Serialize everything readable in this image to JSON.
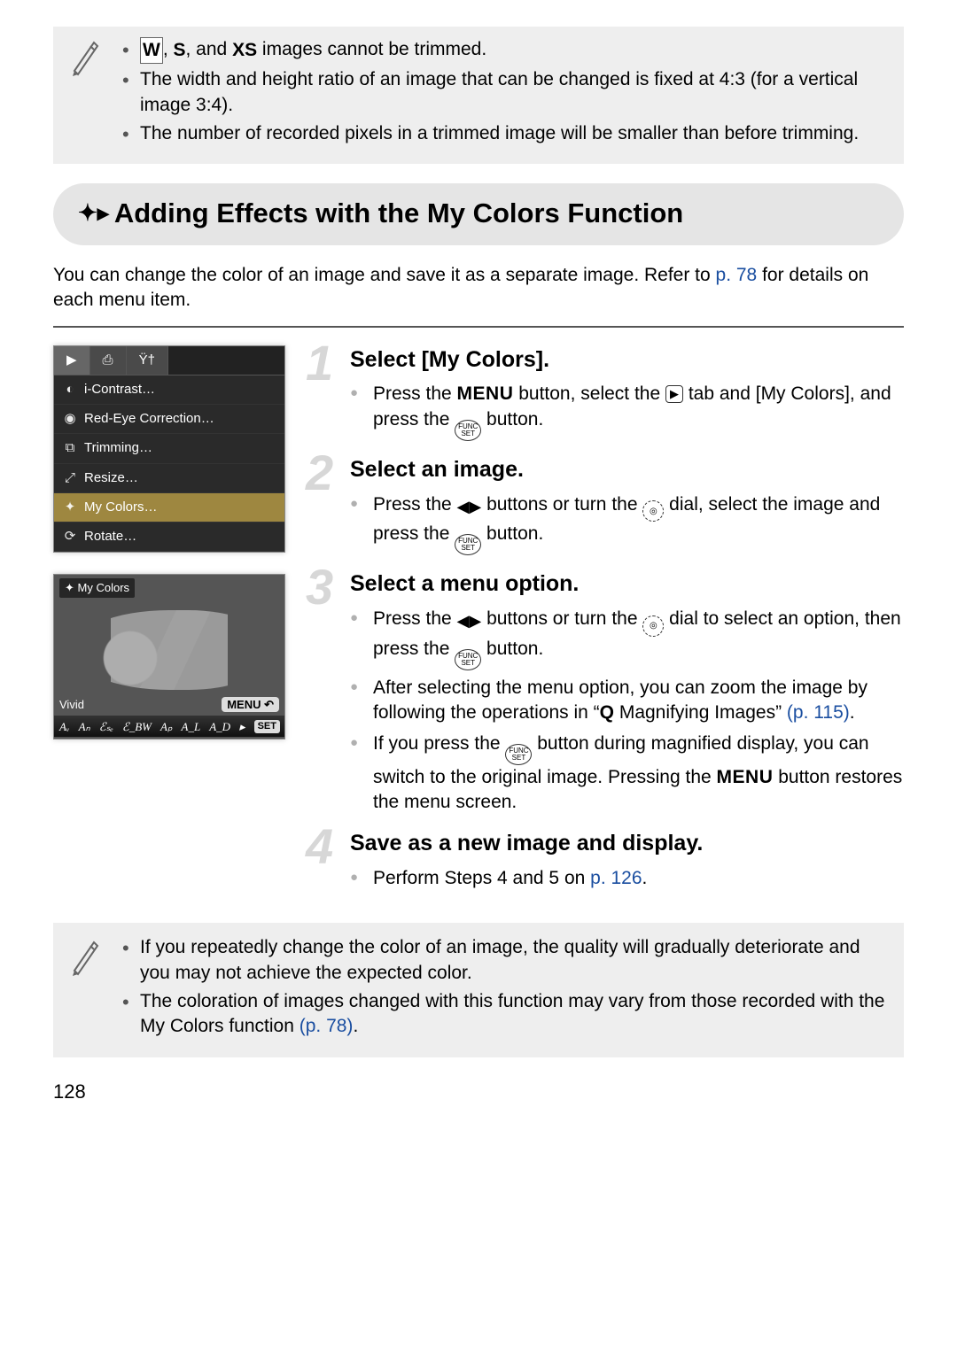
{
  "top_note": {
    "lines": [
      {
        "pre": "",
        "icons": [
          "W",
          "S",
          "XS"
        ],
        "post": " images cannot be trimmed.",
        "joiner1": ", ",
        "joiner2": ", and "
      },
      {
        "text": "The width and height ratio of an image that can be changed is fixed at 4:3 (for a vertical image 3:4)."
      },
      {
        "text": "The number of recorded pixels in a trimmed image will be smaller than before trimming."
      }
    ]
  },
  "heading": "Adding Effects with the My Colors Function",
  "intro_pre": "You can change the color of an image and save it as a separate image. Refer to ",
  "intro_link": "p. 78",
  "intro_post": " for details on each menu item.",
  "lcd_menu": {
    "tabs": [
      "▶",
      "⎙",
      "Ÿ†"
    ],
    "items": [
      {
        "icon": "◐",
        "label": "i-Contrast…"
      },
      {
        "icon": "◉",
        "label": "Red-Eye Correction…"
      },
      {
        "icon": "⧉",
        "label": "Trimming…"
      },
      {
        "icon": "⤢",
        "label": "Resize…"
      },
      {
        "icon": "✦",
        "label": "My Colors…",
        "selected": true
      },
      {
        "icon": "⟳",
        "label": "Rotate…"
      }
    ]
  },
  "preview": {
    "title_icon": "✦",
    "title": "My Colors",
    "mode": "Vivid",
    "menu_label": "MENU",
    "modes_strip": [
      "Aᵥ",
      "Aₙ",
      "ℰₛₑ",
      "ℰ_BW",
      "Aₚ",
      "A_L",
      "A_D",
      "▸"
    ],
    "set_label": "SET"
  },
  "steps": [
    {
      "num": "1",
      "title": "Select [My Colors].",
      "body": [
        {
          "pre": "Press the ",
          "btn": "MENU",
          "mid": " button, select the ",
          "box": "▶",
          "mid2": " tab and [My Colors], and press the ",
          "func": true,
          "post": " button."
        }
      ]
    },
    {
      "num": "2",
      "title": "Select an image.",
      "body": [
        {
          "pre": "Press the ",
          "lr": true,
          "mid": " buttons or turn the ",
          "dial": true,
          "mid2": " dial, select the image and press the ",
          "func": true,
          "post": " button."
        }
      ]
    },
    {
      "num": "3",
      "title": "Select a menu option.",
      "body": [
        {
          "pre": "Press the ",
          "lr": true,
          "mid": " buttons or turn the ",
          "dial": true,
          "mid2": " dial to select an option, then press the ",
          "func": true,
          "post": " button."
        },
        {
          "plain_pre": "After selecting the menu option, you can zoom the image by following the operations in “",
          "mag": true,
          "plain_mid": " Magnifying Images” ",
          "link": "(p. 115)",
          "plain_post": "."
        },
        {
          "pre": "If you press the ",
          "func": true,
          "mid": " button during magnified display, you can switch to the original image. Pressing the ",
          "btn": "MENU",
          "post": " button restores the menu screen."
        }
      ]
    },
    {
      "num": "4",
      "title": "Save as a new image and display.",
      "body": [
        {
          "plain_pre": "Perform Steps 4 and 5 on ",
          "link": "p. 126",
          "plain_post": "."
        }
      ]
    }
  ],
  "bottom_note": {
    "lines": [
      {
        "text": "If you repeatedly change the color of an image, the quality will gradually deteriorate and you may not achieve the expected color."
      },
      {
        "pre": "The coloration of images changed with this function may vary from those recorded with the My Colors function ",
        "link": "(p. 78)",
        "post": "."
      }
    ]
  },
  "page_number": "128"
}
